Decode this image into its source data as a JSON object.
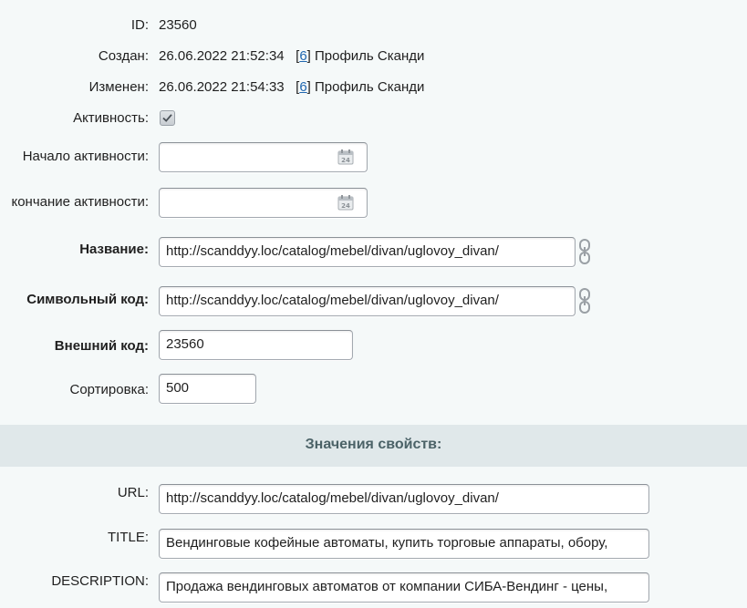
{
  "fields": {
    "id": {
      "label": "ID:",
      "value": "23560"
    },
    "created": {
      "label": "Создан:",
      "date": "26.06.2022 21:52:34",
      "user_id": "6",
      "user_name": "] Профиль Сканди"
    },
    "modified": {
      "label": "Изменен:",
      "date": "26.06.2022 21:54:33",
      "user_id": "6",
      "user_name": "] Профиль Сканди"
    },
    "active": {
      "label": "Активность:",
      "checked": true
    },
    "active_from": {
      "label": "Начало активности:",
      "value": "",
      "icon": "calendar-icon"
    },
    "active_to": {
      "label": "кончание активности:",
      "value": "",
      "icon": "calendar-icon"
    },
    "name": {
      "label": "Название:",
      "value": "http://scanddyy.loc/catalog/mebel/divan/uglovoy_divan/",
      "icon": "link-chain-icon"
    },
    "code": {
      "label": "Символьный код:",
      "value": "http://scanddyy.loc/catalog/mebel/divan/uglovoy_divan/",
      "icon": "link-chain-icon"
    },
    "xml_id": {
      "label": "Внешний код:",
      "value": "23560"
    },
    "sort": {
      "label": "Сортировка:",
      "value": "500"
    }
  },
  "properties": {
    "title": "Значения свойств:",
    "url": {
      "label": "URL:",
      "value": "http://scanddyy.loc/catalog/mebel/divan/uglovoy_divan/"
    },
    "meta_title": {
      "label": "TITLE:",
      "value": "Вендинговые кофейные автоматы, купить торговые аппараты, обору,"
    },
    "description": {
      "label": "DESCRIPTION:",
      "value": "Продажа вендинговых автоматов от компании СИБА-Вендинг - цены,"
    }
  },
  "colors": {
    "background": "#f5f9f9",
    "section_bg": "#e0e8ea",
    "link": "#2067b0"
  }
}
